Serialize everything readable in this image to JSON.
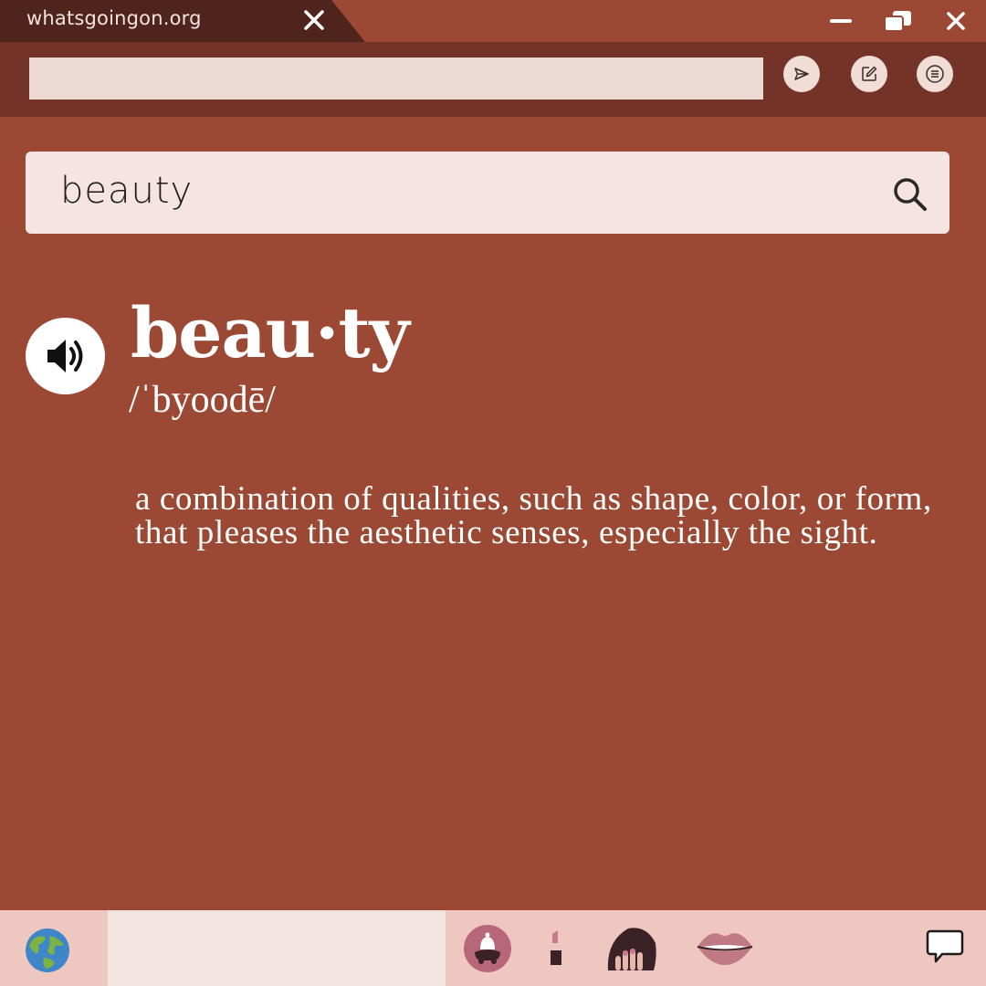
{
  "tab": {
    "title": "whatsgoingon.org",
    "close_icon": "close-icon"
  },
  "window_controls": {
    "minimize_icon": "minimize-icon",
    "restore_icon": "restore-icon",
    "close_icon": "close-icon"
  },
  "toolbar": {
    "address_value": "",
    "send_icon": "send-icon",
    "edit_icon": "edit-icon",
    "list_icon": "list-icon"
  },
  "search": {
    "query": "beauty",
    "icon": "search-icon"
  },
  "entry": {
    "speaker_icon": "speaker-icon",
    "headword": "beau·ty",
    "pronunciation": "/ˈbyoodē/",
    "definition": "a combination of qualities, such as shape, color, or form, that pleases the aesthetic senses, especially the sight."
  },
  "dock": {
    "items": [
      "globe-icon",
      "bell-icon",
      "lipstick-icon",
      "nail-polish-icon",
      "lips-icon",
      "chat-icon"
    ]
  },
  "colors": {
    "background": "#9b4834",
    "tab": "#4f241c",
    "toolbar": "#733427",
    "search_box": "#f5e4e1",
    "dock": "#eec8c0"
  }
}
